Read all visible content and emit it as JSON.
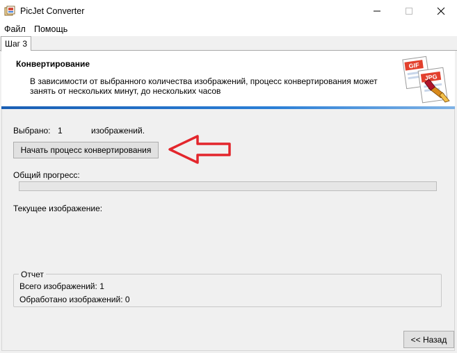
{
  "window": {
    "title": "PicJet Converter",
    "icon": "picjet-app-icon",
    "controls": {
      "minimize": "—",
      "maximize": "☐",
      "close": "✕"
    }
  },
  "menu": {
    "items": [
      {
        "label": "Файл"
      },
      {
        "label": "Помощь"
      }
    ]
  },
  "tabs": [
    {
      "label": "Шаг 3",
      "active": true
    }
  ],
  "header": {
    "title": "Конвертирование",
    "description": "В зависимости от выбранного количества изображений, процесс конвертирования может занять от нескольких минут, до нескольких часов",
    "art": {
      "icon": "file-formats-icon",
      "label_1": "GIF",
      "label_2": "JPG"
    },
    "accent_color": "#2b7fd6"
  },
  "selection": {
    "label": "Выбрано:",
    "count": "1",
    "suffix": "изображений."
  },
  "start_button": {
    "label": "Начать процесс конвертирования"
  },
  "annotation_arrow": {
    "icon": "red-arrow-pointing-left",
    "color": "#e3262c"
  },
  "overall_progress": {
    "label": "Общий прогресс:",
    "value": 0
  },
  "current_image": {
    "label": "Текущее изображение:"
  },
  "report": {
    "title": "Отчет",
    "total_label": "Всего изображений:",
    "total_value": "1",
    "processed_label": "Обработано изображений:",
    "processed_value": "0"
  },
  "back_button": {
    "label": "<< Назад"
  }
}
